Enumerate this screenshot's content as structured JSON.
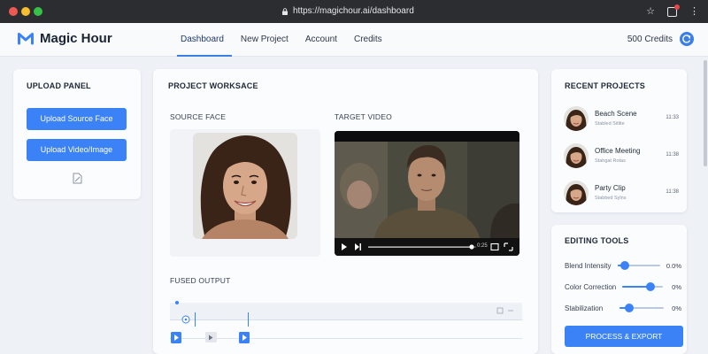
{
  "browser": {
    "url": "https://magichour.ai/dashboard"
  },
  "header": {
    "app_name": "Magic Hour",
    "nav": [
      {
        "label": "Dashboard",
        "active": true
      },
      {
        "label": "New Project",
        "active": false
      },
      {
        "label": "Account",
        "active": false
      },
      {
        "label": "Credits",
        "active": false
      }
    ],
    "credits": "500 Credits"
  },
  "upload_panel": {
    "title": "UPLOAD PANEL",
    "buttons": [
      "Upload Source Face",
      "Upload Video/Image"
    ]
  },
  "workspace": {
    "title": "PROJECT WORKSACE",
    "source_label": "SOURCE FACE",
    "target_label": "TARGET VIDEO",
    "video_time": "0:25",
    "fused_label": "FUSED OUTPUT"
  },
  "recent_projects": {
    "title": "RECENT PROJECTS",
    "items": [
      {
        "name": "Beach Scene",
        "status": "Stabled Sitlite",
        "time": "11:33"
      },
      {
        "name": "Office Meeting",
        "status": "Stahgat Rotas",
        "time": "11:38"
      },
      {
        "name": "Party Clip",
        "status": "Stabbed Sylns",
        "time": "11:38"
      }
    ]
  },
  "editing_tools": {
    "title": "EDITING TOOLS",
    "controls": [
      {
        "label": "Blend Intensity",
        "value_text": "0.0%",
        "level": 0.17
      },
      {
        "label": "Color Correction",
        "value_text": "0%",
        "level": 0.69
      },
      {
        "label": "Stabilization",
        "value_text": "0%",
        "level": 0.22
      }
    ],
    "export_label": "PROCESS & EXPORT"
  },
  "colors": {
    "accent": "#3b82f6",
    "chrome": "#2b2d31",
    "background": "#eef1f6"
  }
}
